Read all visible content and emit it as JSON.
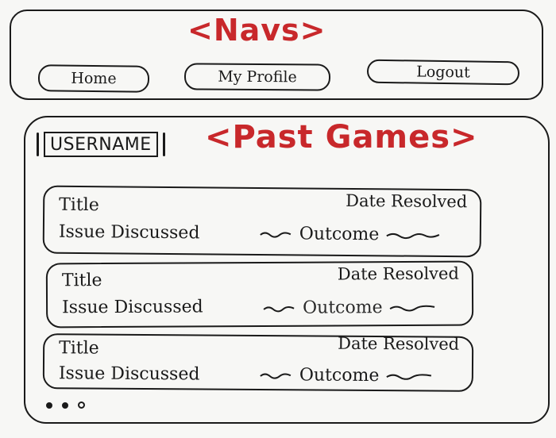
{
  "nav": {
    "label": "<Navs>",
    "buttons": {
      "home": "Home",
      "profile": "My Profile",
      "logout": "Logout"
    }
  },
  "past_games": {
    "label": "<Past Games>",
    "username": "USERNAME",
    "cards": [
      {
        "title": "Title",
        "date": "Date Resolved",
        "issue": "Issue Discussed",
        "outcome": "Outcome"
      },
      {
        "title": "Title",
        "date": "Date Resolved",
        "issue": "Issue Discussed",
        "outcome": "Outcome"
      },
      {
        "title": "Title",
        "date": "Date Resolved",
        "issue": "Issue Discussed",
        "outcome": "Outcome"
      }
    ]
  },
  "colors": {
    "annotation": "#c8282b",
    "ink": "#1a1a1a",
    "paper": "#f7f7f5"
  }
}
